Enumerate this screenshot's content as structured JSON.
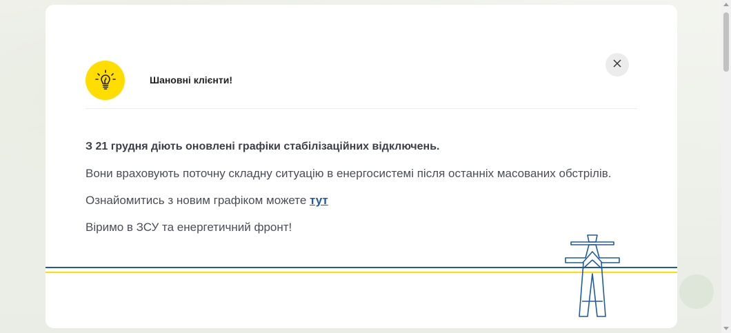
{
  "modal": {
    "title": "Шановні клієнти!",
    "close_label": "×",
    "icon": "lightbulb-icon",
    "lead": "З 21 грудня діють оновлені графіки стабілізаційних відключень.",
    "paragraph_1": "Вони враховують поточну складну ситуацію в енергосистемі після останніх масованих обстрілів.",
    "paragraph_2_prefix": "Ознайомитись з новим графіком можете ",
    "paragraph_2_link": "тут",
    "paragraph_3": "Віримо в ЗСУ та енергетичний фронт!"
  },
  "colors": {
    "accent_yellow": "#ffdd00",
    "accent_blue": "#1f5a9c",
    "text": "#4a4d57"
  },
  "decor": {
    "tower_icon": "power-line-tower-icon"
  }
}
